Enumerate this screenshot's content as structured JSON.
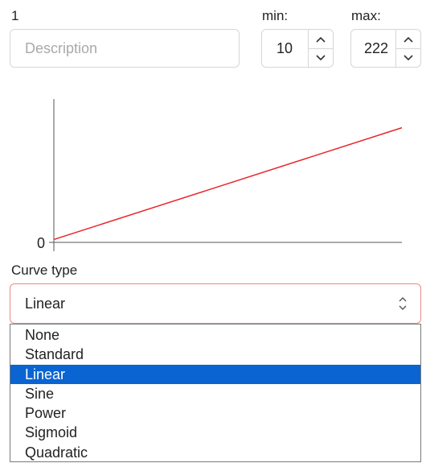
{
  "header": {
    "index_label": "1",
    "description": {
      "placeholder": "Description",
      "value": ""
    },
    "min": {
      "label": "min:",
      "value": "10"
    },
    "max": {
      "label": "max:",
      "value": "222"
    }
  },
  "chart_data": {
    "type": "line",
    "title": "",
    "xlabel": "",
    "ylabel": "",
    "yticks": [
      "0"
    ],
    "series": [
      {
        "color": "#e8262b",
        "x": [
          0,
          1
        ],
        "y": [
          0.02,
          0.8
        ]
      }
    ],
    "xlim": [
      0,
      1
    ],
    "ylim": [
      0,
      1
    ],
    "grid": false
  },
  "curve": {
    "label": "Curve type",
    "selected": "Linear",
    "options": [
      "None",
      "Standard",
      "Linear",
      "Sine",
      "Power",
      "Sigmoid",
      "Quadratic"
    ],
    "selected_index": 2,
    "error_border_color": "#e98a8a",
    "highlight_color": "#0a64d2"
  }
}
